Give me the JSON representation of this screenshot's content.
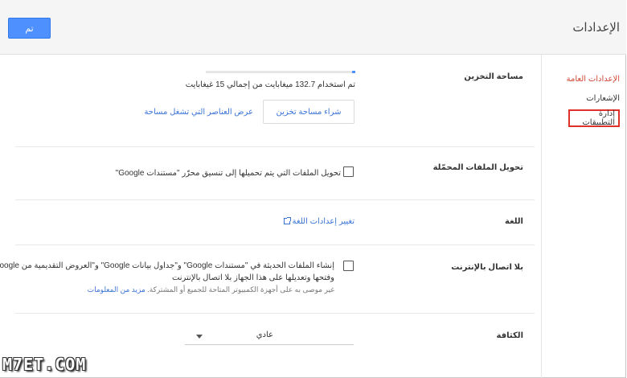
{
  "header": {
    "title": "الإعدادات",
    "done_label": "تم"
  },
  "sidebar": {
    "items": [
      {
        "label": "الإعدادات العامة"
      },
      {
        "label": "الإشعارات"
      },
      {
        "label": "إدارة التطبيقات"
      }
    ]
  },
  "settings": {
    "storage": {
      "label": "مساحة التخزين",
      "used_text": "تم استخدام 132.7 ميغابايت من إجمالي 15 غيغابايت",
      "used_fraction": 0.009,
      "buy_label": "شراء مساحة تخزين",
      "view_link": "عرض العناصر التي تشغل مساحة"
    },
    "convert": {
      "label": "تحويل الملفات المحمّلة",
      "checkbox_text": "تحويل الملفات التي يتم تحميلها إلى تنسيق محرّر \"مستندات Google\"",
      "checked": false
    },
    "language": {
      "label": "اللغة",
      "link_text": "تغيير إعدادات اللغة"
    },
    "offline": {
      "label": "بلا اتصال بالإنترنت",
      "line1": "إنشاء الملفات الحديثة في \"مستندات Google\" و\"جداول بيانات Google\" و\"العروض التقديمية من Google\"",
      "line2": "وفتحها وتعديلها على هذا الجهاز بلا اتصال بالإنترنت",
      "note": "غير موصى به على أجهزة الكمبيوتر المتاحة للجميع أو المشتركة.",
      "more_link": "مزيد من المعلومات",
      "checked": false
    },
    "density": {
      "label": "الكثافة",
      "value": "عادي"
    }
  },
  "watermark": "M7ET.COM",
  "colors": {
    "accent": "#4d90fe",
    "link": "#3b74d6",
    "active_nav": "#d14836",
    "highlight_box": "#e0302a"
  }
}
